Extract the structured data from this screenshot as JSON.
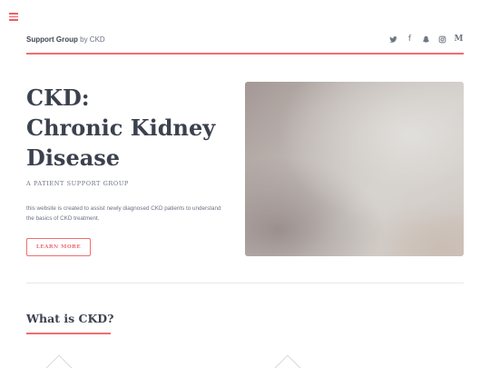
{
  "nav": {
    "menu_icon": "hamburger-icon"
  },
  "header": {
    "brand_strong": "Support Group",
    "brand_light": "by CKD",
    "social": [
      {
        "name": "twitter-icon"
      },
      {
        "name": "facebook-icon",
        "glyph": "f"
      },
      {
        "name": "snapchat-icon"
      },
      {
        "name": "instagram-icon"
      },
      {
        "name": "medium-icon",
        "glyph": "M"
      }
    ],
    "accent_color": "#ef6e72"
  },
  "hero": {
    "title_line1": "CKD:",
    "title_line2": "Chronic Kidney",
    "title_line3": "Disease",
    "tagline": "A PATIENT SUPPORT GROUP",
    "intro": "this website is created to assist newly diagnosed CKD patients to understand the basics of CKD treatment.",
    "cta_label": "LEARN MORE"
  },
  "section": {
    "title": "What is CKD?"
  }
}
